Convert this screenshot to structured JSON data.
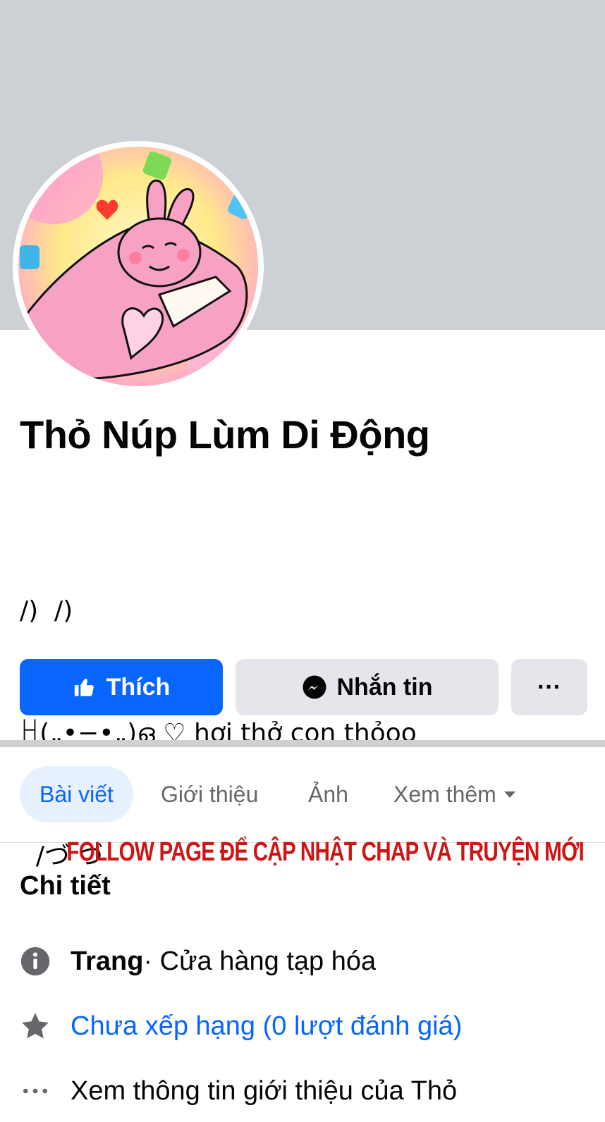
{
  "profile": {
    "name": "Thỏ Núp Lùm Di Động",
    "bio_lines": [
      "/)  /)",
      "ꀿ(„•−•„)ഒ ♡ hơi thở con thỏoo",
      "  /づ づ"
    ]
  },
  "actions": {
    "like_label": "Thích",
    "message_label": "Nhắn tin",
    "more_label": "···"
  },
  "tabs": [
    {
      "label": "Bài viết",
      "active": true
    },
    {
      "label": "Giới thiệu",
      "active": false
    },
    {
      "label": "Ảnh",
      "active": false
    },
    {
      "label": "Xem thêm",
      "active": false
    }
  ],
  "watermark": "FOLLOW PAGE ĐỂ CẬP NHẬT CHAP VÀ TRUYỆN MỚI",
  "details": {
    "title": "Chi tiết",
    "page_type_strong": "Trang",
    "page_type_rest": " · Cửa hàng tạp hóa",
    "rating": "Chưa xếp hạng (0 lượt đánh giá)",
    "about_link": "Xem thông tin giới thiệu của Thỏ"
  },
  "colors": {
    "primary": "#0866ff",
    "cover": "#cdd0d5",
    "watermark": "#d01313",
    "secondary_button": "#e4e6eb"
  }
}
